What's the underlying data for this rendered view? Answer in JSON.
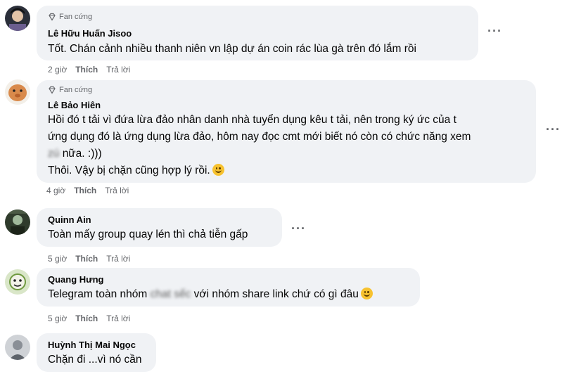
{
  "comments": [
    {
      "badge": "Fan cứng",
      "author": "Lê Hữu Huấn Jisoo",
      "lines": [
        "Tốt. Chán cảnh nhiều thanh niên vn lập dự án coin rác lùa gà trên đó lắm rồi"
      ],
      "time": "2 giờ",
      "like": "Thích",
      "reply": "Trả lời",
      "more": "···"
    },
    {
      "badge": "Fan cứng",
      "author": "Lê Bảo Hiên",
      "lines": [
        "Hồi đó t tải vì đứa lừa đảo nhân danh nhà tuyển dụng kêu t tải, nên trong ký ức của t",
        "ứng dụng đó là ứng dụng lừa đảo, hôm nay đọc cmt mới biết nó còn có chức năng xem",
        "nữa. :)))",
        "Thôi. Vậy bị chặn cũng hợp lý rồi."
      ],
      "blurred": "zú",
      "time": "4 giờ",
      "like": "Thích",
      "reply": "Trả lời",
      "more": "···"
    },
    {
      "author": "Quinn Ain",
      "lines": [
        "Toàn mấy group quay lén thì chả tiễn gấp"
      ],
      "time": "5 giờ",
      "like": "Thích",
      "reply": "Trả lời",
      "more": "···"
    },
    {
      "author": "Quang Hưng",
      "text_before": "Telegram toàn nhóm",
      "blurred": "chat sếc",
      "text_after": "với nhóm share link chứ có gì đâu",
      "time": "5 giờ",
      "like": "Thích",
      "reply": "Trả lời"
    },
    {
      "author": "Huỳnh Thị Mai Ngọc",
      "lines": [
        "Chặn đi ...vì nó cần"
      ]
    }
  ],
  "colors": {
    "bubble": "#f0f2f5",
    "meta": "#65676b",
    "text": "#050505"
  }
}
